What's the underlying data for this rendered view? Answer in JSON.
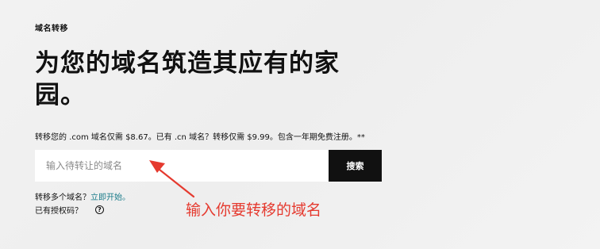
{
  "breadcrumb": "域名转移",
  "headline": "为您的域名筑造其应有的家园。",
  "subtext": "转移您的 .com 域名仅需 $8.67。已有 .cn 域名？转移仅需 $9.99。包含一年期免费注册。**",
  "search": {
    "placeholder": "输入待转让的域名",
    "value": "",
    "button_label": "搜索"
  },
  "multi_transfer": {
    "prefix": "转移多个域名？",
    "link_label": "立即开始。"
  },
  "auth_code": {
    "label": "已有授权码？",
    "icon": "help-circle-icon"
  },
  "annotation": {
    "text": "输入你要转移的域名",
    "color": "#e53a2f"
  }
}
